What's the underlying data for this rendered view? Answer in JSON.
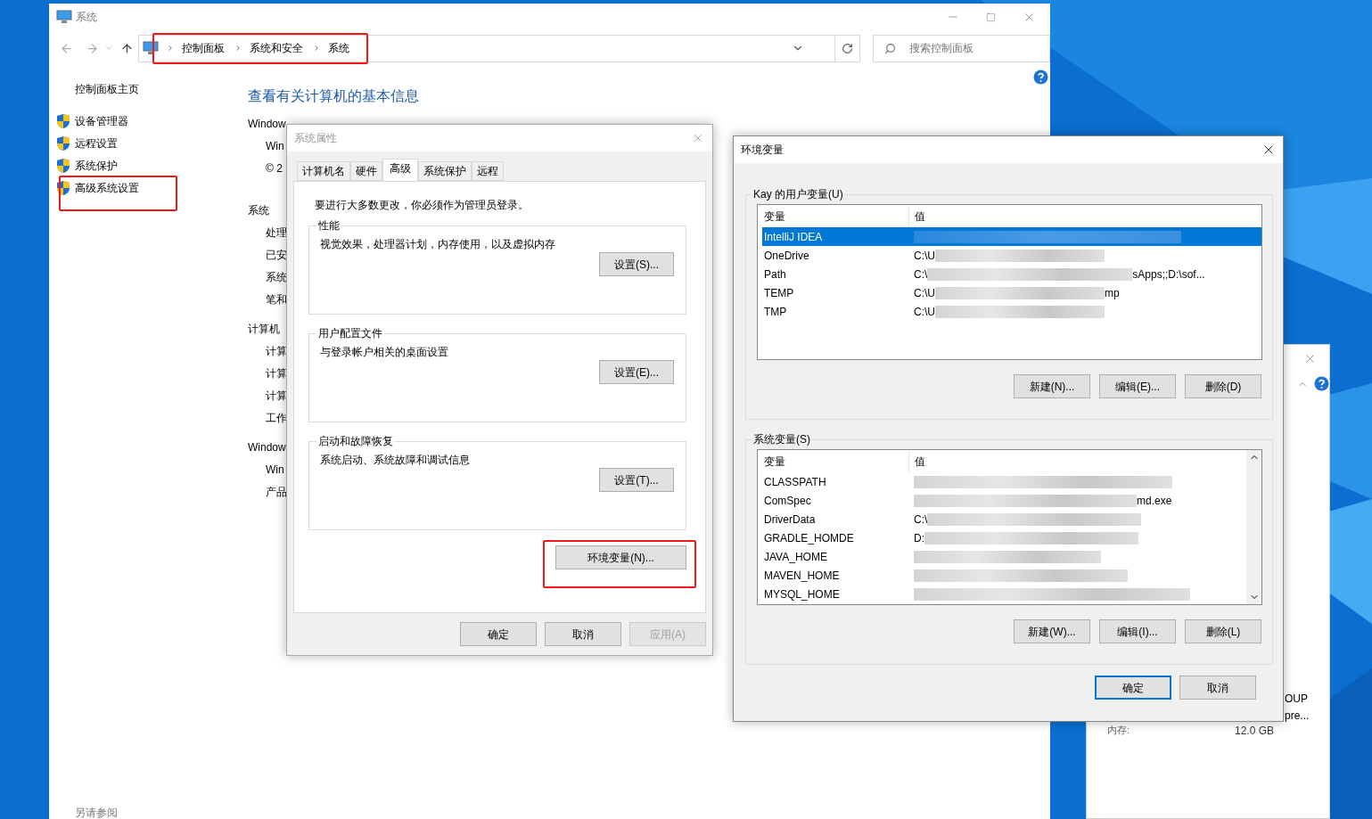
{
  "main_window": {
    "title": "系统",
    "breadcrumb": [
      "控制面板",
      "系统和安全",
      "系统"
    ],
    "search": {
      "placeholder": "搜索控制面板"
    },
    "sidebar": {
      "home": "控制面板主页",
      "items": [
        {
          "label": "设备管理器"
        },
        {
          "label": "远程设置"
        },
        {
          "label": "系统保护"
        },
        {
          "label": "高级系统设置"
        }
      ],
      "see_also": "另请参阅"
    },
    "heading": "查看有关计算机的基本信息",
    "sections": [
      {
        "title": "Window",
        "rows": [
          "Win",
          "© 2"
        ]
      },
      {
        "title": "系统",
        "rows": [
          "处理",
          "已安",
          "系统",
          "笔和"
        ]
      },
      {
        "title": "计算机",
        "rows": [
          "计算",
          "计算",
          "计算",
          "工作"
        ]
      },
      {
        "title": "Window",
        "rows": [
          "Win",
          "产品"
        ]
      }
    ]
  },
  "system_properties": {
    "title": "系统属性",
    "tabs": [
      {
        "label": "计算机名",
        "selected": false
      },
      {
        "label": "硬件",
        "selected": false
      },
      {
        "label": "高级",
        "selected": true
      },
      {
        "label": "系统保护",
        "selected": false
      },
      {
        "label": "远程",
        "selected": false
      }
    ],
    "notice": "要进行大多数更改，你必须作为管理员登录。",
    "groups": [
      {
        "title": "性能",
        "description": "视觉效果，处理器计划，内存使用，以及虚拟内存",
        "button": "设置(S)..."
      },
      {
        "title": "用户配置文件",
        "description": "与登录帐户相关的桌面设置",
        "button": "设置(E)..."
      },
      {
        "title": "启动和故障恢复",
        "description": "系统启动、系统故障和调试信息",
        "button": "设置(T)..."
      }
    ],
    "env_button": "环境变量(N)...",
    "buttons": [
      {
        "label": "确定",
        "disabled": false
      },
      {
        "label": "取消",
        "disabled": false
      },
      {
        "label": "应用(A)",
        "disabled": true
      }
    ]
  },
  "env_vars": {
    "title": "环境变量",
    "user_vars": {
      "title": "Kay 的用户变量(U)",
      "columns": [
        "变量",
        "值"
      ],
      "rows": [
        {
          "name": "IntelliJ IDEA",
          "selected": true
        },
        {
          "name": "OneDrive",
          "value_start": "C:\\U",
          "selected": false
        },
        {
          "name": "Path",
          "value_start": "C:\\",
          "value_end": "sApps;;D:\\sof...",
          "selected": false
        },
        {
          "name": "TEMP",
          "value_start": "C:\\U",
          "value_end": "mp",
          "selected": false
        },
        {
          "name": "TMP",
          "value_start": "C:\\U",
          "selected": false
        }
      ],
      "buttons": [
        "新建(N)...",
        "编辑(E)...",
        "删除(D)"
      ]
    },
    "system_vars": {
      "title": "系统变量(S)",
      "columns": [
        "变量",
        "值"
      ],
      "rows": [
        {
          "name": "CLASSPATH",
          "selected": false
        },
        {
          "name": "ComSpec",
          "value_end": "md.exe",
          "selected": false
        },
        {
          "name": "DriverData",
          "value_start": "C:\\",
          "selected": false
        },
        {
          "name": "GRADLE_HOMDE",
          "value_start": "D:",
          "selected": false
        },
        {
          "name": "JAVA_HOME",
          "selected": false
        },
        {
          "name": "MAVEN_HOME",
          "selected": false
        },
        {
          "name": "MYSQL_HOME",
          "selected": false
        }
      ],
      "buttons": [
        "新建(W)...",
        "编辑(I)...",
        "删除(L)"
      ]
    },
    "buttons": [
      {
        "label": "确定",
        "default": true
      },
      {
        "label": "取消",
        "default": false
      }
    ]
  },
  "background_window": {
    "labels": [
      "OUP",
      "pre..."
    ],
    "memory_label": "内存:",
    "memory_value": "12.0 GB"
  }
}
